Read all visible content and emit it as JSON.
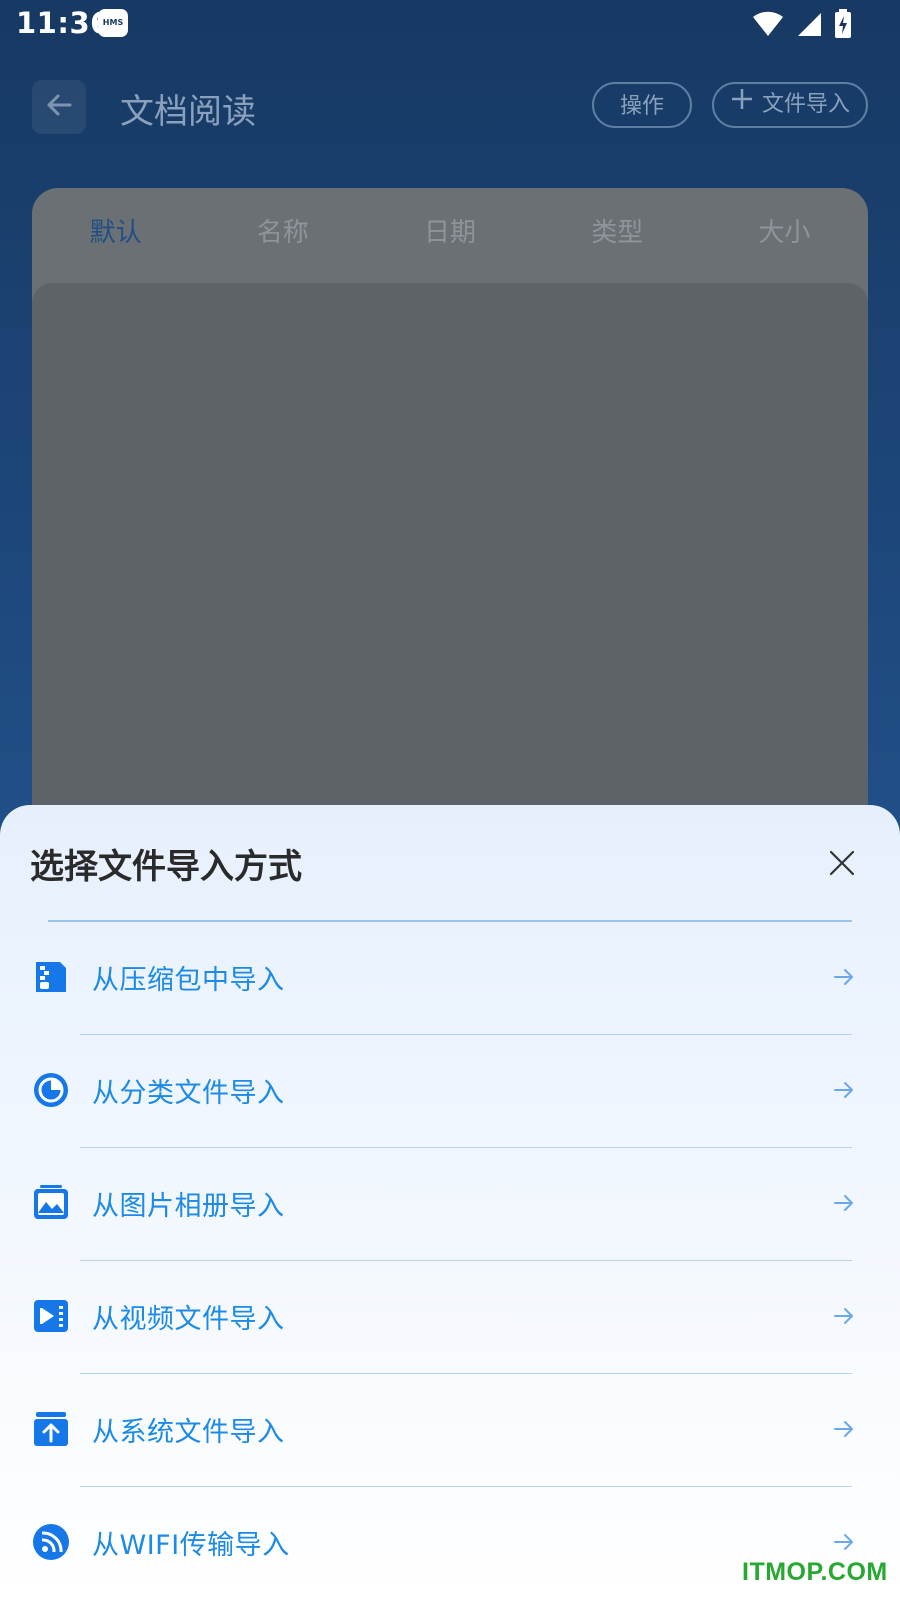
{
  "status_bar": {
    "time": "11:36",
    "badge": "HMS",
    "icons": [
      "wifi-icon",
      "signal-icon",
      "battery-charging-icon"
    ]
  },
  "header": {
    "title": "文档阅读",
    "back_icon": "back-arrow-icon",
    "operate_label": "操作",
    "import_label": "文件导入",
    "import_icon": "plus-icon"
  },
  "sort_tabs": [
    {
      "label": "默认",
      "active": true
    },
    {
      "label": "名称",
      "active": false
    },
    {
      "label": "日期",
      "active": false
    },
    {
      "label": "类型",
      "active": false
    },
    {
      "label": "大小",
      "active": false
    }
  ],
  "sheet": {
    "title": "选择文件导入方式",
    "close_icon": "close-icon",
    "options": [
      {
        "label": "从压缩包中导入",
        "icon": "zip-icon"
      },
      {
        "label": "从分类文件导入",
        "icon": "pie-chart-icon"
      },
      {
        "label": "从图片相册导入",
        "icon": "image-icon"
      },
      {
        "label": "从视频文件导入",
        "icon": "video-icon"
      },
      {
        "label": "从系统文件导入",
        "icon": "upload-box-icon"
      },
      {
        "label": "从WIFI传输导入",
        "icon": "wifi-transfer-icon"
      }
    ]
  },
  "watermark": "ITMOP.COM",
  "colors": {
    "accent": "#1c8ae6",
    "icon_blue": "#1677e8",
    "watermark_green": "#27a830"
  }
}
